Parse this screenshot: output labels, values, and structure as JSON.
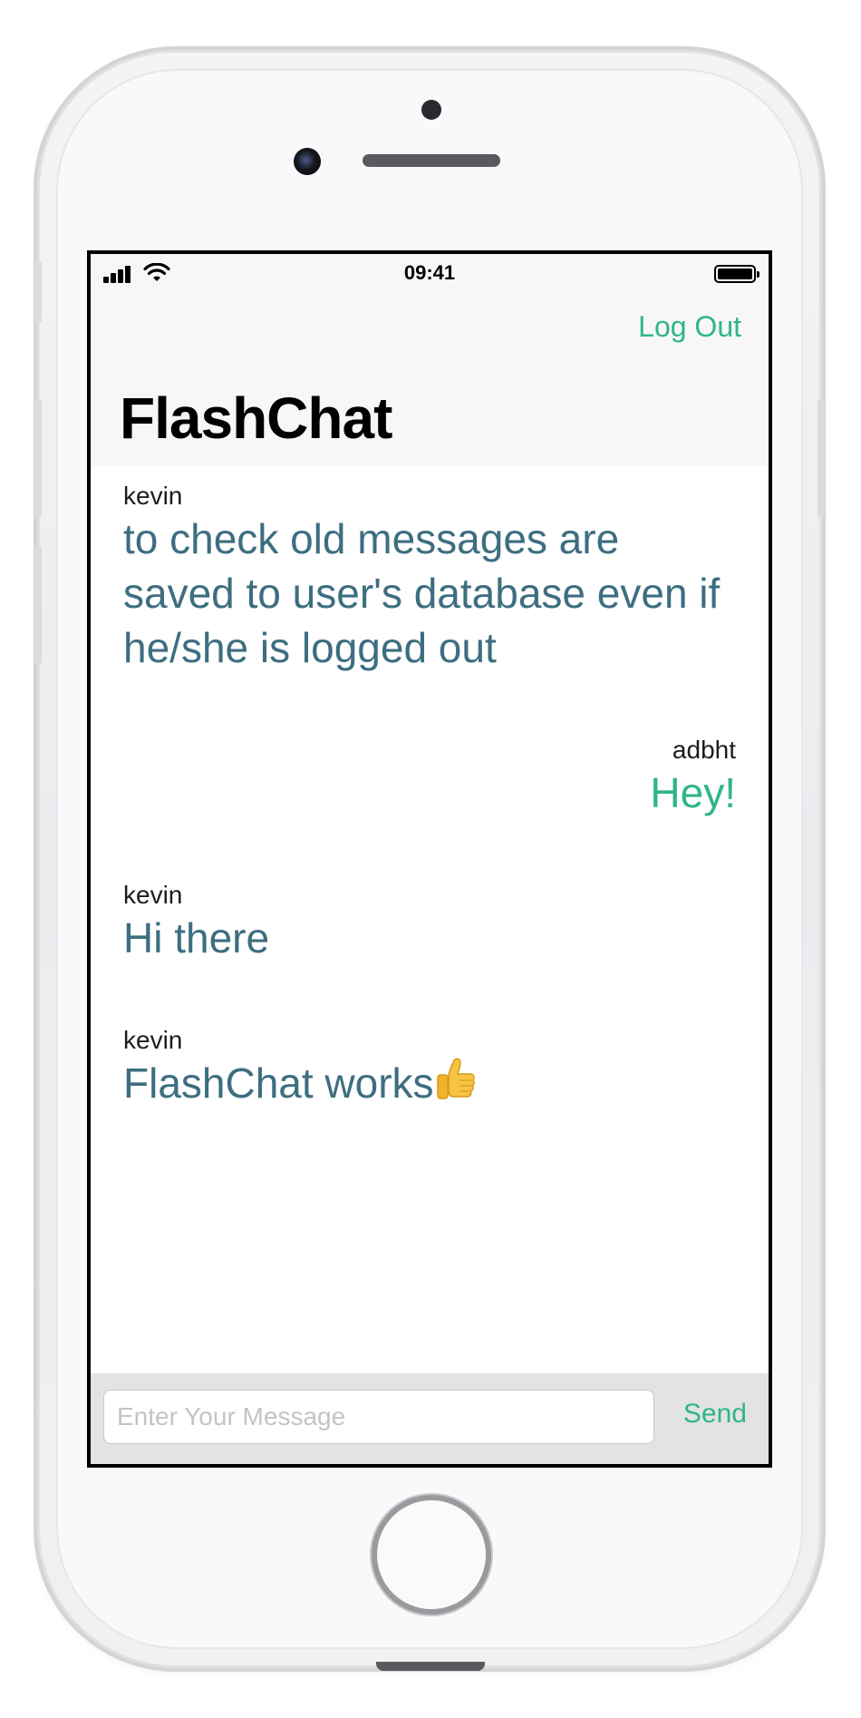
{
  "statusbar": {
    "time": "09:41"
  },
  "navbar": {
    "logout_label": "Log Out",
    "title": "FlashChat"
  },
  "messages": [
    {
      "sender": "kevin",
      "body": "to check old messages are saved to user's database even if he/she is logged out",
      "own": false
    },
    {
      "sender": "adbht",
      "body": "Hey!",
      "own": true
    },
    {
      "sender": "kevin",
      "body": "Hi there",
      "own": false
    },
    {
      "sender": "kevin",
      "body": "FlashChat works",
      "own": false,
      "emoji": "thumbs-up"
    }
  ],
  "composer": {
    "placeholder": "Enter Your Message",
    "value": "",
    "send_label": "Send"
  },
  "colors": {
    "accent": "#2fb58a",
    "incoming_text": "#3d6e80",
    "navbar_bg": "#f7f7f7",
    "composer_bg": "#e3e3e3"
  }
}
